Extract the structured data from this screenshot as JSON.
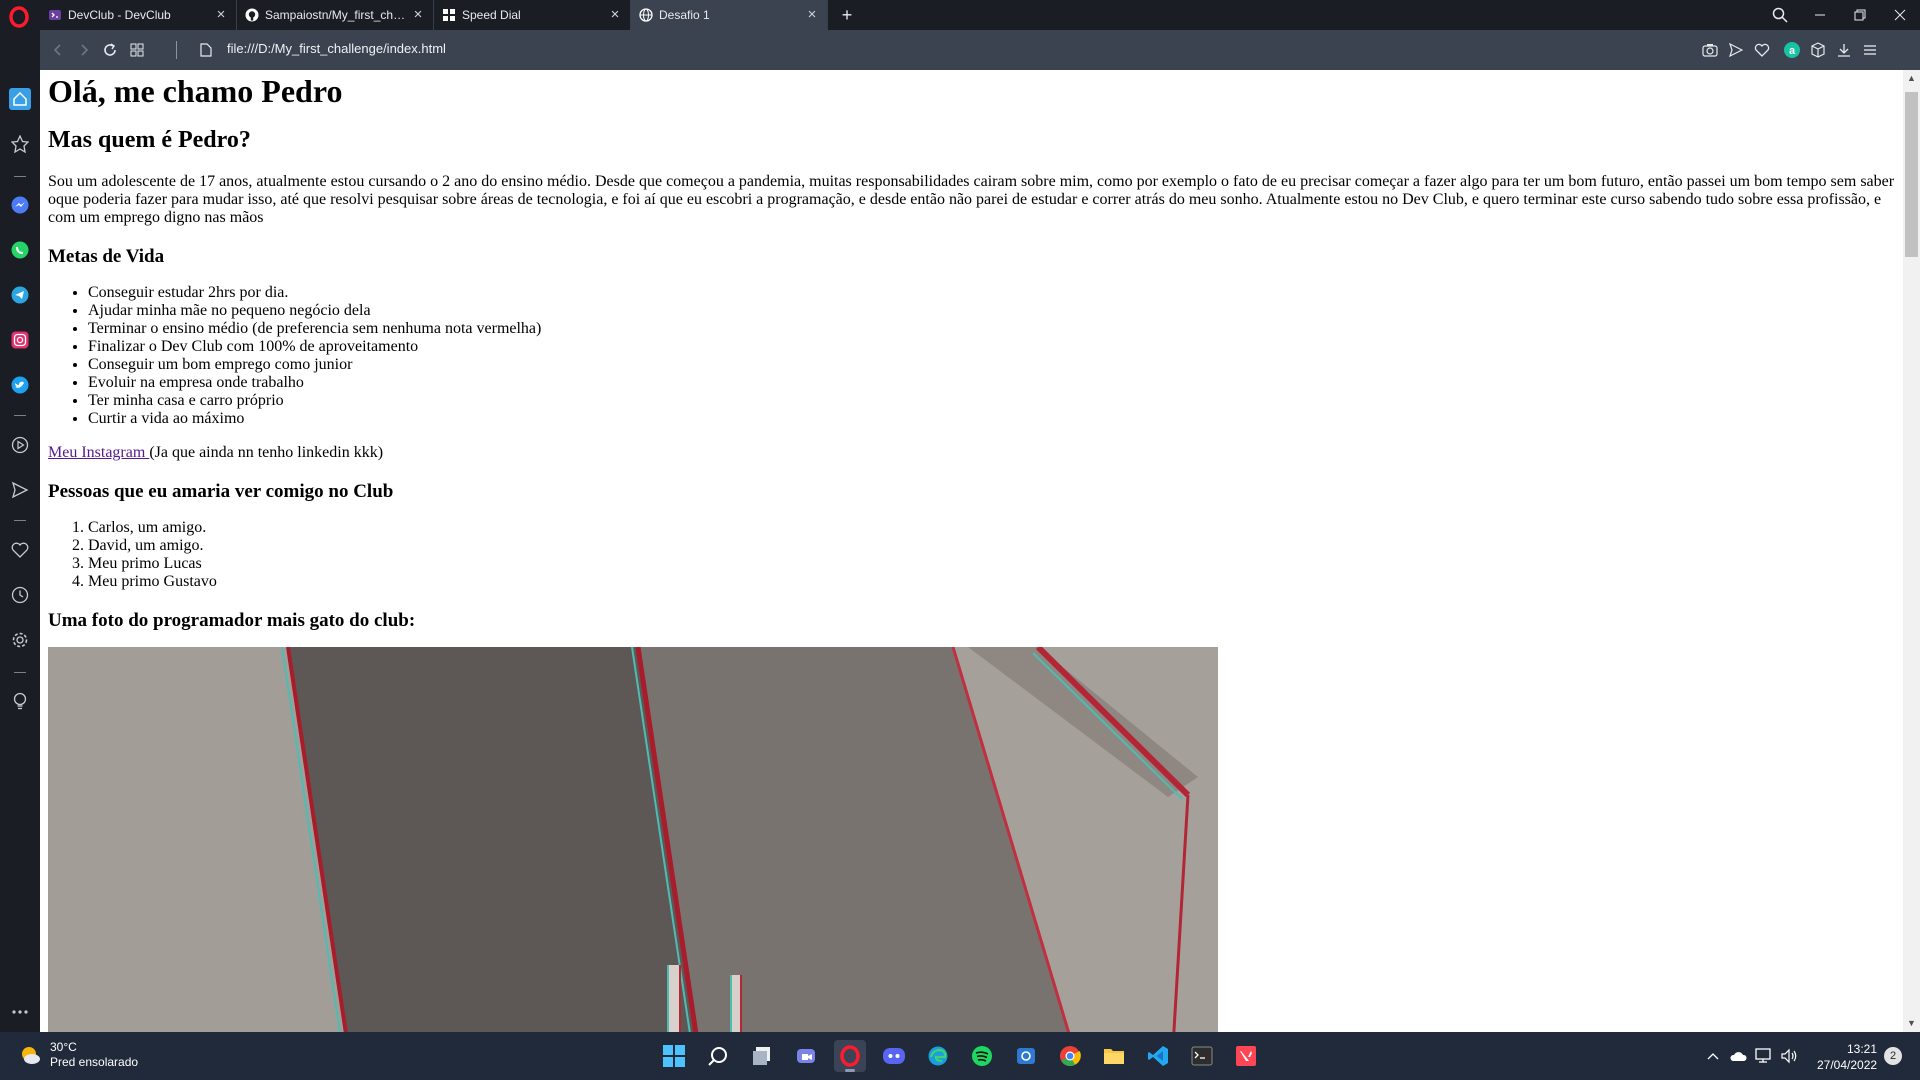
{
  "browser": {
    "tabs": [
      {
        "title": "DevClub - DevClub",
        "favicon": "devclub-icon",
        "active": false
      },
      {
        "title": "Sampaiostn/My_first_challe",
        "favicon": "github-icon",
        "active": false
      },
      {
        "title": "Speed Dial",
        "favicon": "speed-dial-icon",
        "active": false
      },
      {
        "title": "Desafio 1",
        "favicon": "globe-icon",
        "active": true
      }
    ],
    "new_tab_label": "+",
    "url": "file:///D:/My_first_challenge/index.html",
    "accent_color": "#3b4250"
  },
  "page": {
    "h1": "Olá, me chamo Pedro",
    "h2": "Mas quem é Pedro?",
    "intro": "Sou um adolescente de 17 anos, atualmente estou cursando o 2 ano do ensino médio. Desde que começou a pandemia, muitas responsabilidades cairam sobre mim, como por exemplo o fato de eu precisar começar a fazer algo para ter um bom futuro, então passei um bom tempo sem saber oque poderia fazer para mudar isso, até que resolvi pesquisar sobre áreas de tecnologia, e foi aí que eu escobri a programação, e desde então não parei de estudar e correr atrás do meu sonho. Atualmente estou no Dev Club, e quero terminar este curso sabendo tudo sobre essa profissão, e com um emprego digno nas mãos",
    "goals_heading": "Metas de Vida",
    "goals": [
      "Conseguir estudar 2hrs por dia.",
      "Ajudar minha mãe no pequeno negócio dela",
      "Terminar o ensino médio (de preferencia sem nenhuma nota vermelha)",
      "Finalizar o Dev Club com 100% de aproveitamento",
      "Conseguir um bom emprego como junior",
      "Evoluir na empresa onde trabalho",
      "Ter minha casa e carro próprio",
      "Curtir a vida ao máximo"
    ],
    "instagram_link": "Meu Instagram ",
    "instagram_note": "(Ja que ainda nn tenho linkedin kkk)",
    "people_heading": "Pessoas que eu amaria ver comigo no Club",
    "people": [
      "Carlos, um amigo.",
      "David, um amigo.",
      "Meu primo Lucas",
      "Meu primo Gustavo"
    ],
    "photo_heading": "Uma foto do programador mais gato do club:"
  },
  "taskbar": {
    "temperature": "30°C",
    "weather": "Pred ensolarado",
    "time": "13:21",
    "date": "27/04/2022",
    "notifications": "2"
  }
}
